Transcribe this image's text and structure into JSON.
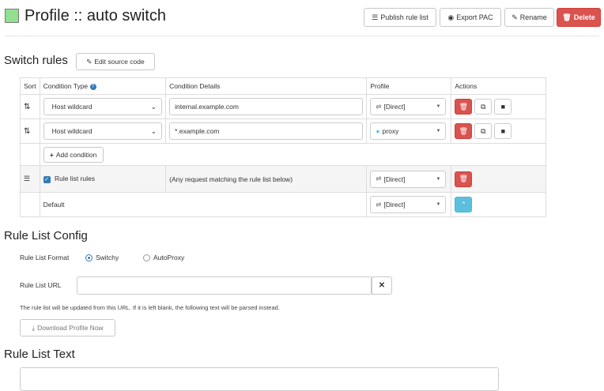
{
  "header": {
    "title": "Profile :: auto switch",
    "color": "#90e090",
    "buttons": {
      "publish": "Publish rule list",
      "export": "Export PAC",
      "rename": "Rename",
      "delete": "Delete"
    }
  },
  "switch_rules": {
    "title": "Switch rules",
    "edit_source_label": "Edit source code",
    "columns": {
      "sort": "Sort",
      "condition_type": "Condition Type",
      "condition_details": "Condition Details",
      "profile": "Profile",
      "actions": "Actions"
    },
    "rules": [
      {
        "condition_type": "Host wildcard",
        "condition_details": "internal.example.com",
        "profile": "[Direct]",
        "profile_icon": "direct-icon"
      },
      {
        "condition_type": "Host wildcard",
        "condition_details": "*.example.com",
        "profile": "proxy",
        "profile_icon": "globe-icon"
      }
    ],
    "add_condition_label": "Add condition",
    "rule_list_row": {
      "label": "Rule list rules",
      "checked": true,
      "details": "(Any request matching the rule list below)",
      "profile": "[Direct]"
    },
    "default_row": {
      "label": "Default",
      "profile": "[Direct]"
    }
  },
  "rule_list_config": {
    "title": "Rule List Config",
    "format_label": "Rule List Format",
    "format_options": [
      "Switchy",
      "AutoProxy"
    ],
    "format_selected": "Switchy",
    "url_label": "Rule List URL",
    "url_value": "",
    "help_text": "The rule list will be updated from this URL. If it is left blank, the following text will be parsed instead.",
    "download_label": "Download Profile Now"
  },
  "rule_list_text": {
    "title": "Rule List Text",
    "value": ""
  },
  "colors": {
    "danger": "#d9534f",
    "info": "#5bc0de",
    "primary": "#337ab7"
  }
}
